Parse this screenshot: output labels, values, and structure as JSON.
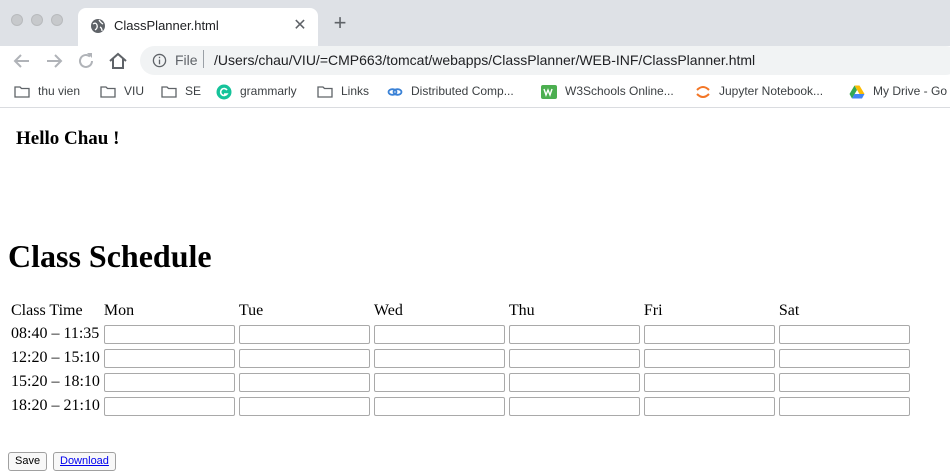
{
  "browser": {
    "tab_title": "ClassPlanner.html",
    "tab_close": "✕",
    "new_tab": "+",
    "scheme": "File",
    "url": "/Users/chau/VIU/=CMP663/tomcat/webapps/ClassPlanner/WEB-INF/ClassPlanner.html",
    "bookmarks": [
      {
        "label": "thu vien",
        "icon": "folder-icon"
      },
      {
        "label": "VIU",
        "icon": "folder-icon"
      },
      {
        "label": "SE",
        "icon": "folder-icon"
      },
      {
        "label": "grammarly",
        "icon": "grammarly-icon"
      },
      {
        "label": "Links",
        "icon": "folder-icon"
      },
      {
        "label": "Distributed Comp...",
        "icon": "link-icon"
      },
      {
        "label": "W3Schools Online...",
        "icon": "w3schools-icon"
      },
      {
        "label": "Jupyter Notebook...",
        "icon": "jupyter-icon"
      },
      {
        "label": "My Drive - Go",
        "icon": "drive-icon"
      }
    ]
  },
  "page": {
    "greeting": "Hello Chau !",
    "heading": "Class Schedule",
    "table": {
      "headers": [
        "Class Time",
        "Mon",
        "Tue",
        "Wed",
        "Thu",
        "Fri",
        "Sat"
      ],
      "times": [
        "08:40 – 11:35",
        "12:20 – 15:10",
        "15:20 – 18:10",
        "18:20 – 21:10"
      ]
    },
    "save_label": "Save",
    "download_label": "Download"
  },
  "colors": {
    "tabstrip": "#dee1e6",
    "link": "#0000ee"
  }
}
